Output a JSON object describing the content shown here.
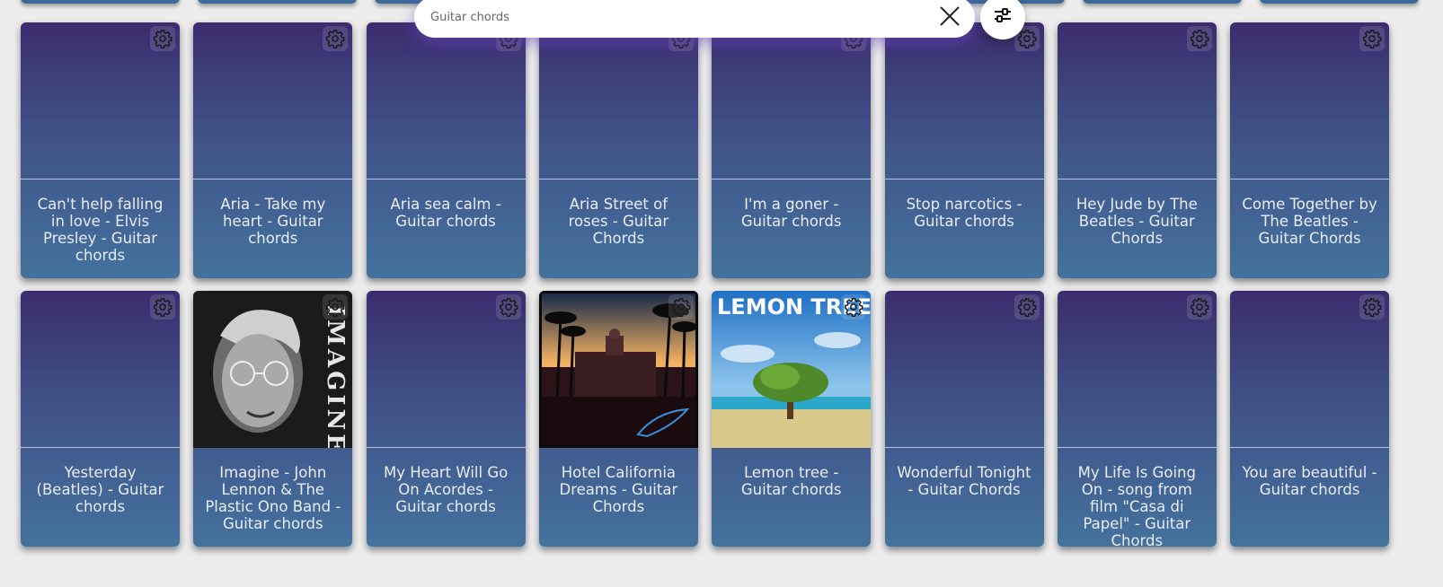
{
  "search": {
    "value": "",
    "placeholder": "Guitar chords"
  },
  "icons": {
    "clear": "close-icon",
    "filter": "sliders-icon",
    "settings": "gear-icon"
  },
  "colors": {
    "card_top": "#3c2c6e",
    "card_bottom": "#44729e",
    "title": "#e8ecf4"
  },
  "cards": [
    {
      "title": "Can't help falling in love - Elvis Presley - Guitar chords",
      "cover": ""
    },
    {
      "title": "Aria - Take my heart - Guitar chords",
      "cover": ""
    },
    {
      "title": "Aria sea calm - Guitar chords",
      "cover": ""
    },
    {
      "title": "Aria Street of roses - Guitar Chords",
      "cover": ""
    },
    {
      "title": "I'm a goner - Guitar chords",
      "cover": ""
    },
    {
      "title": "Stop narcotics - Guitar chords",
      "cover": ""
    },
    {
      "title": "Hey Jude by The Beatles - Guitar Chords",
      "cover": ""
    },
    {
      "title": "Come Together by The Beatles - Guitar Chords",
      "cover": ""
    },
    {
      "title": "Yesterday (Beatles) - Guitar chords",
      "cover": ""
    },
    {
      "title": "Imagine - John Lennon & The Plastic Ono Band - Guitar chords",
      "cover": "imagine",
      "cover_text": "IMAGINE"
    },
    {
      "title": "My Heart Will Go On Acordes - Guitar chords",
      "cover": ""
    },
    {
      "title": "Hotel California Dreams - Guitar Chords",
      "cover": "hotel"
    },
    {
      "title": "Lemon tree - Guitar chords",
      "cover": "lemon",
      "cover_text": "LEMON TREE"
    },
    {
      "title": "Wonderful Tonight - Guitar Chords",
      "cover": ""
    },
    {
      "title": "My Life Is Going On - song from film \"Casa di Papel\" - Guitar Chords",
      "cover": ""
    },
    {
      "title": "You are beautiful - Guitar chords",
      "cover": ""
    }
  ]
}
